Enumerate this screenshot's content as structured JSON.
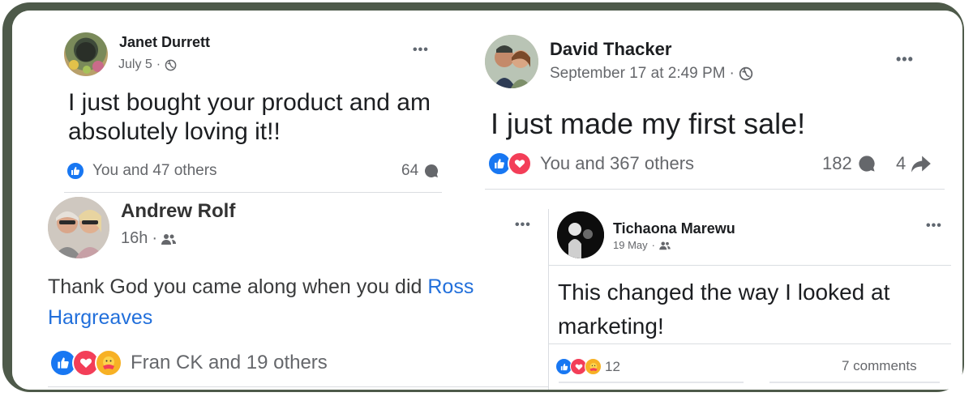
{
  "posts": [
    {
      "author": "Janet Durrett",
      "timestamp": "July 5",
      "audience_icon": "globe-icon",
      "text": "I just bought your product and am absolutely loving it!!",
      "reactions": "You and 47 others",
      "comments": "64"
    },
    {
      "author": "David Thacker",
      "timestamp": "September 17 at 2:49 PM",
      "audience_icon": "globe-icon",
      "text": "I just made my first sale!",
      "reactions": "You and 367 others",
      "comments": "182",
      "shares": "4"
    },
    {
      "author": "Andrew Rolf",
      "timestamp": "16h",
      "audience_icon": "friends-icon",
      "text": "Thank God you came along when you did ",
      "mention": "Ross Hargreaves",
      "reactions": "Fran CK and 19 others"
    },
    {
      "author": "Tichaona Marewu",
      "timestamp": "19 May",
      "audience_icon": "friends-icon",
      "text": "This changed the way I looked at marketing!",
      "reactions": "12",
      "comments": "7 comments"
    }
  ],
  "more_label": "•••",
  "meta_separator": "·",
  "colors": {
    "frame": "#4e5a4a",
    "like": "#1877f2",
    "love": "#f33e58",
    "care": "#f7b125",
    "link": "#216fdb"
  }
}
